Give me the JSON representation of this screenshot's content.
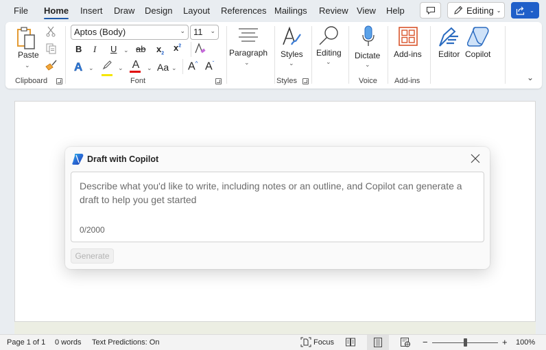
{
  "tabs": [
    {
      "label": "File",
      "active": false
    },
    {
      "label": "Home",
      "active": true
    },
    {
      "label": "Insert",
      "active": false
    },
    {
      "label": "Draw",
      "active": false
    },
    {
      "label": "Design",
      "active": false
    },
    {
      "label": "Layout",
      "active": false
    },
    {
      "label": "References",
      "active": false
    },
    {
      "label": "Mailings",
      "active": false
    },
    {
      "label": "Review",
      "active": false
    },
    {
      "label": "View",
      "active": false
    },
    {
      "label": "Help",
      "active": false
    }
  ],
  "topbar": {
    "comments_icon": "comment-icon",
    "editing_label": "Editing",
    "editing_icon": "pencil-icon",
    "share_icon": "share-icon"
  },
  "ribbon": {
    "clipboard": {
      "paste_label": "Paste",
      "group_label": "Clipboard",
      "icons": [
        "paste-icon",
        "cut-icon",
        "copy-icon",
        "format-painter-icon"
      ]
    },
    "font": {
      "font_name": "Aptos (Body)",
      "font_size": "11",
      "bold": "B",
      "italic": "I",
      "underline": "U",
      "strikethrough": "ab",
      "subscript": "x",
      "superscript": "x",
      "clear_formatting_icon": "clear-formatting-icon",
      "text_effects": "A",
      "highlight_color": "#f5e600",
      "font_color": "#e00000",
      "font_color_glyph": "A",
      "change_case": "Aa",
      "grow_font": "A",
      "shrink_font": "A",
      "group_label": "Font"
    },
    "paragraph": {
      "label": "Paragraph"
    },
    "styles": {
      "label": "Styles",
      "group_label": "Styles"
    },
    "editing": {
      "label": "Editing"
    },
    "voice": {
      "label": "Dictate",
      "group_label": "Voice"
    },
    "addins": {
      "label": "Add-ins",
      "group_label": "Add-ins"
    },
    "editor": {
      "label": "Editor"
    },
    "copilot": {
      "label": "Copilot"
    }
  },
  "dialog": {
    "title": "Draft with Copilot",
    "placeholder": "Describe what you'd like to write, including notes or an outline, and Copilot can generate a draft to help you get started",
    "char_count": "0/2000",
    "generate_label": "Generate",
    "generate_enabled": false
  },
  "statusbar": {
    "page": "Page 1 of 1",
    "words": "0 words",
    "text_predictions": "Text Predictions: On",
    "focus_label": "Focus",
    "zoom_minus": "−",
    "zoom_plus": "+",
    "zoom_level": "100%",
    "zoom_percent": 100
  },
  "colors": {
    "accent": "#1f5fc9",
    "tab_underline": "#1f5aa9",
    "background": "#e9edf1"
  }
}
